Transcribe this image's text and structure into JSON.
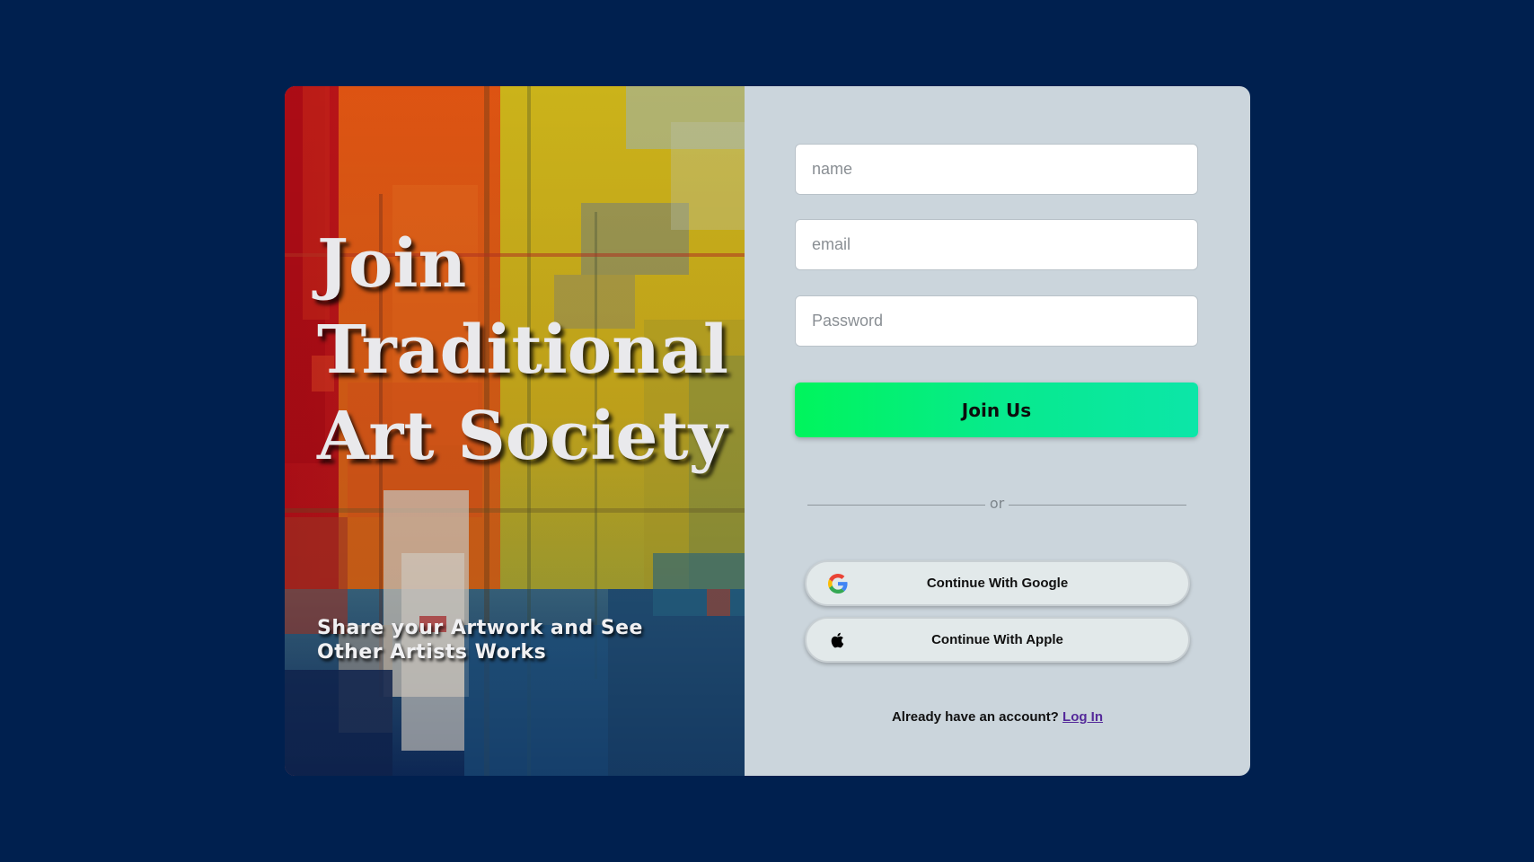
{
  "hero": {
    "headline_line1": "Join",
    "headline_line2": "Traditional",
    "headline_line3": "Art Society",
    "tagline": "Share your Artwork and See Other Artists Works"
  },
  "form": {
    "name_placeholder": "name",
    "email_placeholder": "email",
    "password_placeholder": "Password",
    "join_label": "Join Us",
    "divider_label": "or",
    "google_label": "Continue With Google",
    "apple_label": "Continue With Apple",
    "already_text": "Already have an account?",
    "login_link": "Log In"
  },
  "icons": {
    "google": "google-icon",
    "apple": "apple-icon"
  },
  "colors": {
    "page_background": "#00204f",
    "form_panel": "#cbd5dc",
    "join_gradient_start": "#00f55c",
    "join_gradient_end": "#0ce6a8",
    "login_link": "#552a9a"
  }
}
